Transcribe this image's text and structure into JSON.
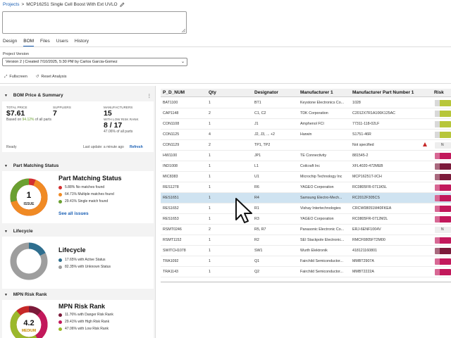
{
  "breadcrumb": {
    "root": "Projects",
    "separator": ">",
    "project": "MCP16251 Single Cell Boost With Ext UVLO"
  },
  "tabs": [
    "Design",
    "BOM",
    "Files",
    "Users",
    "History"
  ],
  "project_version": {
    "label": "Project Version",
    "value": "Version 2 | Created 7/10/2025, 5:30 PM by Carlos Garcia-Gomez"
  },
  "toolbar": {
    "fullscreen": "Fullscreen",
    "reset": "Reset Analysis"
  },
  "price_summary": {
    "title": "BOM Price & Summary",
    "total_price_label": "TOTAL PRICE",
    "total_price": "$7.61",
    "based_on_prefix": "Based on",
    "based_on_pct": "94.12%",
    "based_on_suffix": "of all parts",
    "suppliers_label": "SUPPLIERS",
    "suppliers": "7",
    "manufacturers_label": "MANUFACTURERS",
    "manufacturers": "15",
    "low_risk_label": "WITH LOW RISK RANK",
    "low_risk": "8 / 17",
    "low_risk_pct": "47.06% of all parts",
    "status": "Ready",
    "last_update": "Last update: a minute ago",
    "refresh": "Refresh"
  },
  "part_matching": {
    "section": "Part Matching Status",
    "title": "Part Matching Status",
    "center_value": "1",
    "center_label": "ISSUE",
    "legend": [
      {
        "text": "5.88% No matches found",
        "color": "#d32f2f",
        "pct": 5.88
      },
      {
        "text": "64.71% Multiple matches found",
        "color": "#f08a24",
        "pct": 64.71
      },
      {
        "text": "29.41% Single match found",
        "color": "#6aa031",
        "pct": 29.41
      }
    ],
    "see_all": "See all issues"
  },
  "lifecycle": {
    "section": "Lifecycle",
    "title": "Lifecycle",
    "legend": [
      {
        "text": "17.65% with Active Status",
        "color": "#2e6e8e",
        "pct": 17.65
      },
      {
        "text": "82.35% with Unknown Status",
        "color": "#9e9e9e",
        "pct": 82.35
      }
    ]
  },
  "mpn_risk": {
    "section": "MPN Risk Rank",
    "title": "MPN Risk Rank",
    "center_value": "4.2",
    "center_label": "MEDIUM",
    "legend": [
      {
        "text": "11.76% with Danger Risk Rank",
        "color": "#7b1a3a",
        "pct": 11.76
      },
      {
        "text": "29.41% with High Risk Rank",
        "color": "#c2185b",
        "pct": 29.41
      },
      {
        "text": "47.06% with Low Risk Rank",
        "color": "#9bb82c",
        "pct": 47.06
      }
    ]
  },
  "table": {
    "headers": [
      "P_D_NUM",
      "Qty",
      "Designator",
      "Manufacturer 1",
      "Manufacturer Part Number 1",
      "Risk"
    ],
    "rows": [
      [
        "BAT1100",
        "1",
        "BT1",
        "Keystone Electronics Co...",
        "1028",
        "#b7c63a"
      ],
      [
        "CAP1148",
        "2",
        "C1, C2",
        "TDK Corporation",
        "C2012X7R1A106K125AC",
        "#b7c63a"
      ],
      [
        "CON1108",
        "1",
        "J1",
        "Amphenol FCI",
        "77311-118-02LF",
        "#b7c63a"
      ],
      [
        "CON1125",
        "4",
        "J2, J3, ... +2",
        "Harwin",
        "S1751-46R",
        "#b7c63a"
      ],
      [
        "CON1129",
        "2",
        "TP1, TP2",
        "",
        "Not specified",
        "#eeeeee"
      ],
      [
        "HW1100",
        "1",
        "JP1",
        "TE Connectivity",
        "881545-2",
        "#c2185b"
      ],
      [
        "IND1008",
        "1",
        "L1",
        "Coilcraft Inc",
        "XFL4020-472MEB",
        "#7b1a3a"
      ],
      [
        "MIC8383",
        "1",
        "U1",
        "Microchip Technology Inc",
        "MCP16251T-I/CH",
        "#7b1a3a"
      ],
      [
        "RES1278",
        "1",
        "R6",
        "YAGEO Corporation",
        "RC0805FR-0711K5L",
        "#c2185b"
      ],
      [
        "RES1651",
        "1",
        "R4",
        "Samsung Electro-Mech...",
        "RC2012F305CS",
        "#c2185b"
      ],
      [
        "RES1652",
        "1",
        "R1",
        "Vishay Intertechnologies",
        "CRCW08051M40FKEA",
        "#c2185b"
      ],
      [
        "RES1653",
        "1",
        "R3",
        "YAGEO Corporation",
        "RC0805FR-0712M2L",
        "#c2185b"
      ],
      [
        "RSMT0246",
        "2",
        "R5, R7",
        "Panasonic Electronic Co...",
        "ERJ-6ENF1004V",
        "#eeeeee"
      ],
      [
        "RSMT1152",
        "1",
        "R2",
        "SEI Stackpole Electronic...",
        "RMCF0805FT2M00",
        "#c2185b"
      ],
      [
        "SWITCH1078",
        "1",
        "SW1",
        "Wurth Elektronik",
        "418121160801",
        "#7b1a3a"
      ],
      [
        "TRA1092",
        "1",
        "Q1",
        "Fairchild Semiconductor...",
        "MMBT2907A",
        "#c2185b"
      ],
      [
        "TRA1143",
        "1",
        "Q2",
        "Fairchild Semiconductor...",
        "MMBT2222A",
        "#c2185b"
      ]
    ]
  }
}
